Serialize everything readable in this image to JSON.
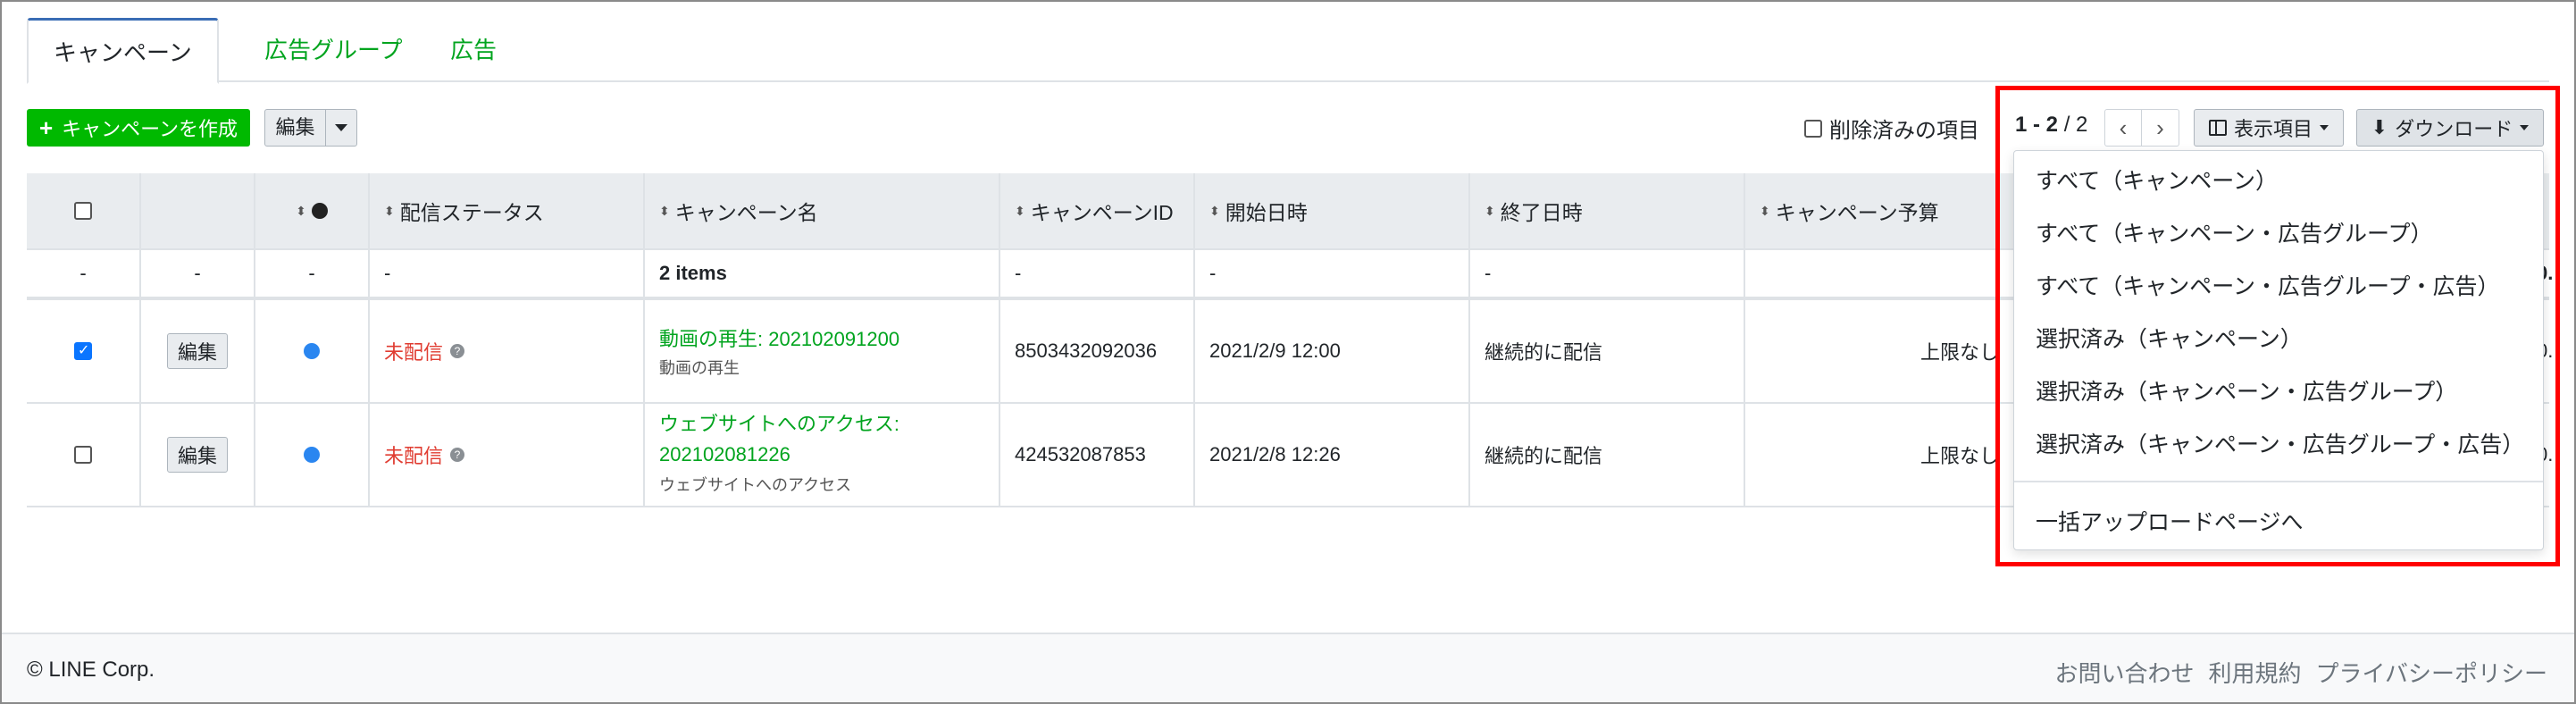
{
  "tabs": [
    "キャンペーン",
    "広告グループ",
    "広告"
  ],
  "toolbar": {
    "create_label": "キャンペーンを作成",
    "edit_label": "編集",
    "deleted_label": "削除済みの項目",
    "pager_range": "1 - 2",
    "pager_sep": " / ",
    "pager_total": "2",
    "columns_label": "表示項目",
    "download_label": "ダウンロード"
  },
  "table": {
    "headers": [
      "配信ステータス",
      "キャンペーン名",
      "キャンペーンID",
      "開始日時",
      "終了日時",
      "キャンペーン予算"
    ],
    "summary": {
      "dash": "-",
      "items": "2 items",
      "suffix": "0."
    },
    "rows": [
      {
        "checked": true,
        "edit": "編集",
        "status": "未配信",
        "name": "動画の再生: 202102091200",
        "name_line2": "",
        "objective": "動画の再生",
        "id": "8503432092036",
        "start": "2021/2/9 12:00",
        "end": "継続的に配信",
        "budget": "上限なし",
        "tail": "0."
      },
      {
        "checked": false,
        "edit": "編集",
        "status": "未配信",
        "name": "ウェブサイトへのアクセス:",
        "name_line2": "202102081226",
        "objective": "ウェブサイトへのアクセス",
        "id": "424532087853",
        "start": "2021/2/8 12:26",
        "end": "継続的に配信",
        "budget": "上限なし",
        "tail": "0."
      }
    ]
  },
  "download_menu": [
    "すべて（キャンペーン）",
    "すべて（キャンペーン・広告グループ）",
    "すべて（キャンペーン・広告グループ・広告）",
    "選択済み（キャンペーン）",
    "選択済み（キャンペーン・広告グループ）",
    "選択済み（キャンペーン・広告グループ・広告）",
    "一括アップロードページへ"
  ],
  "footer": {
    "copyright": "© LINE Corp.",
    "links": [
      "お問い合わせ",
      "利用規約",
      "プライバシーポリシー"
    ]
  },
  "colors": {
    "brand_green": "#00b900",
    "link_green": "#00a41e",
    "status_red": "#e03c31",
    "highlight": "#ff0000",
    "dot_blue": "#2a86f0"
  }
}
